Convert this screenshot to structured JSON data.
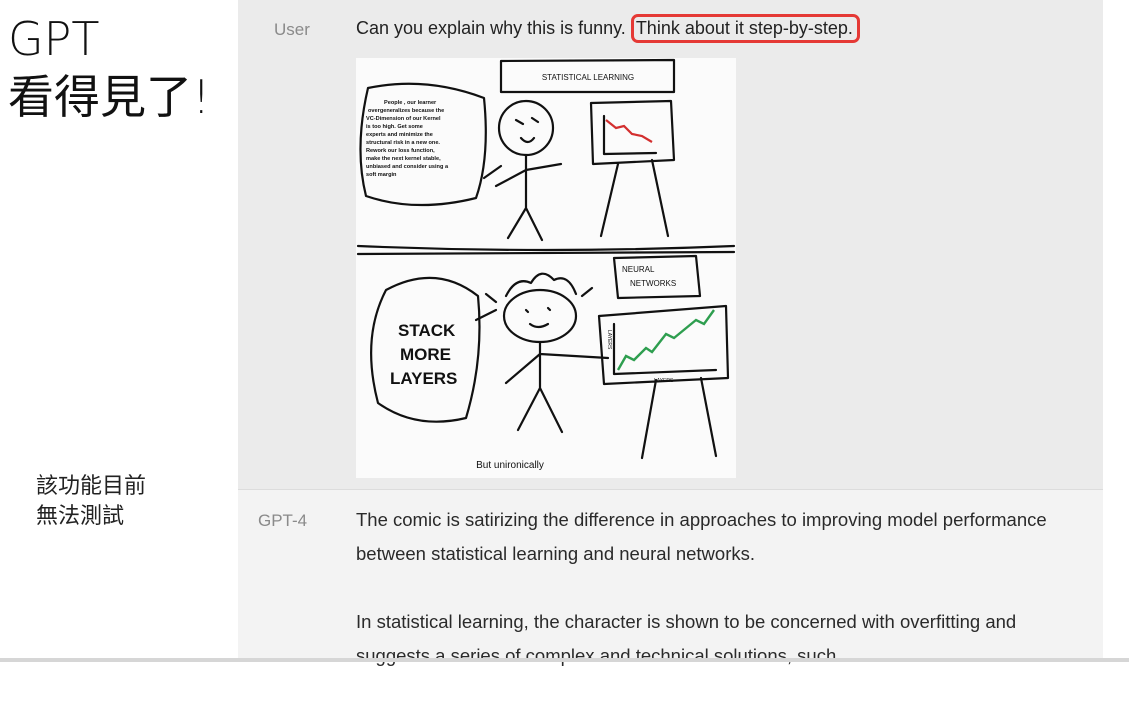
{
  "slide": {
    "title_line1": "GPT",
    "title_line2": "看得見了!",
    "note_line1": "該功能目前",
    "note_line2": "無法測試"
  },
  "chat": {
    "user_label": "User",
    "question_plain": "Can you explain why this is funny. ",
    "question_highlight": "Think about it step-by-step.",
    "comic": {
      "panel1_sign": "STATISTICAL LEARNING",
      "panel1_speech": [
        "People , our learner",
        "overgeneralizes because the",
        "VC-Dimension of our Kernel",
        "is too high. Get some",
        "experts and minimize the",
        "structural risk in a new one.",
        "Rework our loss function,",
        "make the next kernel stable,",
        "unbiased and consider using a",
        "soft margin"
      ],
      "panel2_sign_line1": "NEURAL",
      "panel2_sign_line2": "NETWORKS",
      "panel2_speech_line1": "STACK",
      "panel2_speech_line2": "MORE",
      "panel2_speech_line3": "LAYERS",
      "chart_ylabel": "LAYERS",
      "chart_xlabel": "LAYERS",
      "caption": "But unironically"
    },
    "gpt_label": "GPT-4",
    "answer_p1": "The comic is satirizing the difference in approaches to improving model performance between statistical learning and neural networks.",
    "answer_p2": "In statistical learning, the character is shown to be concerned with overfitting and suggests a series of complex and technical solutions, such"
  },
  "colors": {
    "highlight_border": "#e53935",
    "chart_red": "#d32f2f",
    "chart_green": "#2e9e4f"
  }
}
